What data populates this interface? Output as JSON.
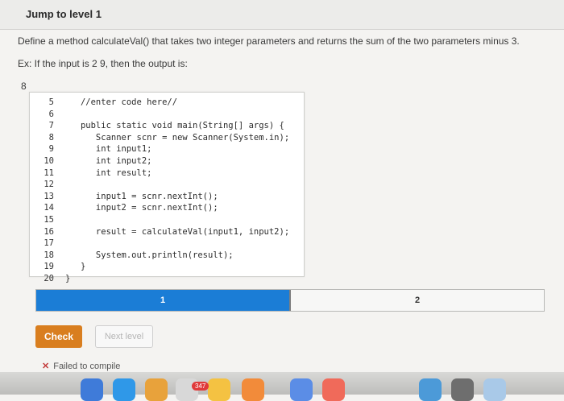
{
  "header": {
    "title": "Jump to level 1"
  },
  "prompt": {
    "text": "Define a method calculateVal() that takes two integer parameters and returns the sum of the two parameters minus 3.",
    "example": "Ex: If the input is 2 9, then the output is:",
    "output_value": "8"
  },
  "code": {
    "lines": [
      {
        "num": "5",
        "text": "   //enter code here//"
      },
      {
        "num": "6",
        "text": ""
      },
      {
        "num": "7",
        "text": "   public static void main(String[] args) {"
      },
      {
        "num": "8",
        "text": "      Scanner scnr = new Scanner(System.in);"
      },
      {
        "num": "9",
        "text": "      int input1;"
      },
      {
        "num": "10",
        "text": "      int input2;"
      },
      {
        "num": "11",
        "text": "      int result;"
      },
      {
        "num": "12",
        "text": ""
      },
      {
        "num": "13",
        "text": "      input1 = scnr.nextInt();"
      },
      {
        "num": "14",
        "text": "      input2 = scnr.nextInt();"
      },
      {
        "num": "15",
        "text": ""
      },
      {
        "num": "16",
        "text": "      result = calculateVal(input1, input2);"
      },
      {
        "num": "17",
        "text": ""
      },
      {
        "num": "18",
        "text": "      System.out.println(result);"
      },
      {
        "num": "19",
        "text": "   }"
      },
      {
        "num": "20",
        "text": "}"
      }
    ]
  },
  "progress": {
    "segments": [
      "1",
      "2"
    ],
    "active_segment": 1
  },
  "buttons": {
    "check": "Check",
    "next": "Next level"
  },
  "status": {
    "message": "Failed to compile"
  },
  "dock": {
    "badge": "347"
  },
  "colors": {
    "accent": "#1b7dd6",
    "check_button": "#d97e1f",
    "error": "#c23a3a"
  }
}
